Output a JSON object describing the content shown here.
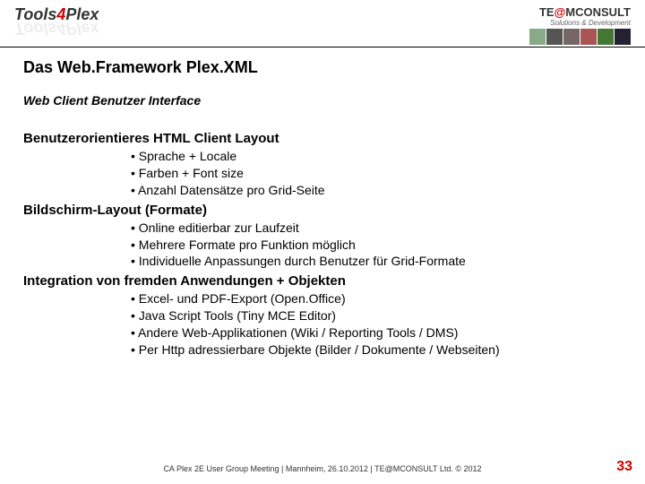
{
  "header": {
    "logo_left_a": "Tools",
    "logo_left_b": "4",
    "logo_left_c": "Plex",
    "logo_right_a": "TE",
    "logo_right_b": "@",
    "logo_right_c": "MCONSULT",
    "logo_right_tagline": "Solutions & Development"
  },
  "title": "Das Web.Framework Plex.XML",
  "subtitle": "Web Client Benutzer Interface",
  "sections": [
    {
      "head": "Benutzerorientieres HTML Client Layout",
      "items": [
        "Sprache + Locale",
        "Farben + Font size",
        "Anzahl Datensätze pro Grid-Seite"
      ]
    },
    {
      "head": "Bildschirm-Layout (Formate)",
      "items": [
        "Online editierbar zur Laufzeit",
        "Mehrere Formate pro Funktion möglich",
        "Individuelle Anpassungen durch Benutzer für Grid-Formate"
      ]
    },
    {
      "head": "Integration von fremden Anwendungen + Objekten",
      "items": [
        "Excel- und PDF-Export (Open.Office)",
        "Java Script Tools (Tiny MCE Editor)",
        "Andere Web-Applikationen (Wiki / Reporting Tools / DMS)",
        "Per Http adressierbare Objekte (Bilder / Dokumente / Webseiten)"
      ]
    }
  ],
  "footer": "CA Plex 2E User Group Meeting | Mannheim, 26.10.2012 | TE@MCONSULT Ltd. © 2012",
  "page_number": "33"
}
